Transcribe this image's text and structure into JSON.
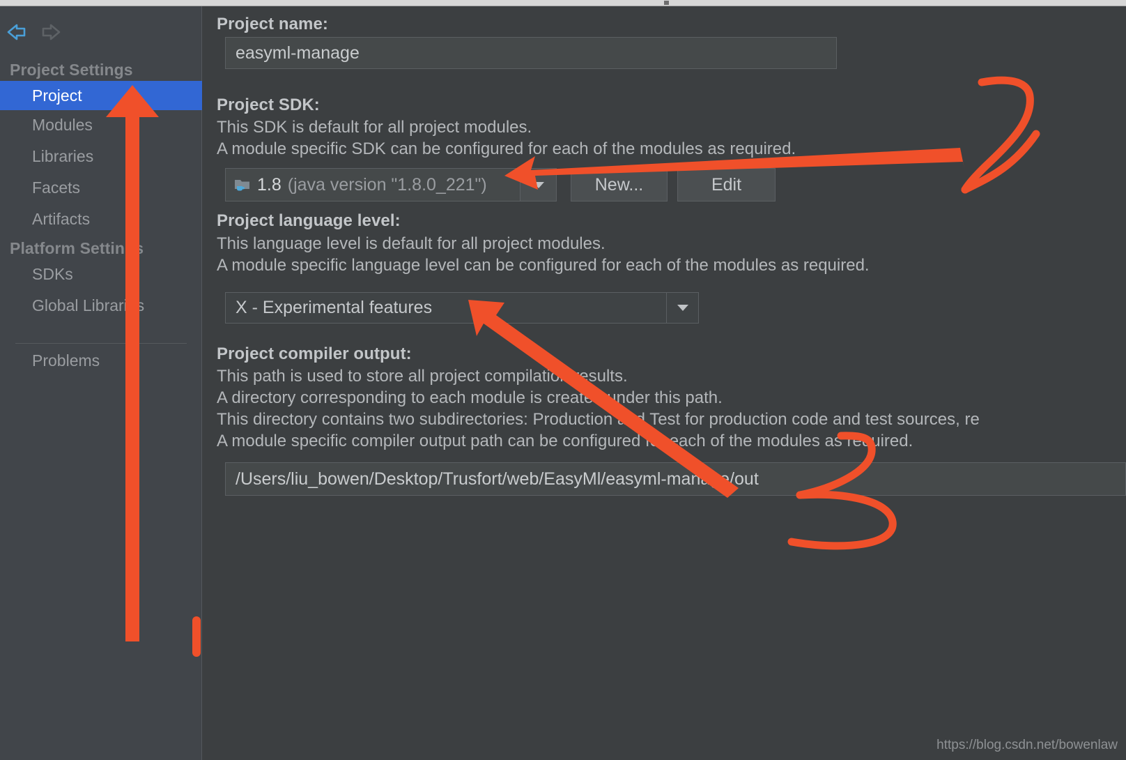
{
  "window": {
    "background_color": "#3c3f41",
    "sidebar_color": "#41454a",
    "accent_color": "#3267d4",
    "annotation_color": "#f0502a"
  },
  "nav": {
    "back_icon": "arrow-left-icon",
    "forward_icon": "arrow-right-icon"
  },
  "sidebar": {
    "groups": [
      {
        "title": "Project Settings",
        "items": [
          {
            "label": "Project",
            "selected": true
          },
          {
            "label": "Modules",
            "selected": false
          },
          {
            "label": "Libraries",
            "selected": false
          },
          {
            "label": "Facets",
            "selected": false
          },
          {
            "label": "Artifacts",
            "selected": false
          }
        ]
      },
      {
        "title": "Platform Settings",
        "items": [
          {
            "label": "SDKs",
            "selected": false
          },
          {
            "label": "Global Libraries",
            "selected": false
          }
        ]
      }
    ],
    "footer_items": [
      {
        "label": "Problems",
        "selected": false
      }
    ]
  },
  "main": {
    "project_name": {
      "label": "Project name:",
      "value": "easyml-manage"
    },
    "project_sdk": {
      "label": "Project SDK:",
      "description_lines": [
        "This SDK is default for all project modules.",
        "A module specific SDK can be configured for each of the modules as required."
      ],
      "selected_version": "1.8",
      "selected_detail": "(java version \"1.8.0_221\")",
      "icon": "jdk-folder-icon",
      "dropdown_icon": "chevron-down-icon",
      "new_button": "New...",
      "edit_button": "Edit"
    },
    "language_level": {
      "label": "Project language level:",
      "description_lines": [
        "This language level is default for all project modules.",
        "A module specific language level can be configured for each of the modules as required."
      ],
      "value": "X - Experimental features",
      "dropdown_icon": "chevron-down-icon"
    },
    "compiler_output": {
      "label": "Project compiler output:",
      "description_lines": [
        "This path is used to store all project compilation results.",
        "A directory corresponding to each module is created under this path.",
        "This directory contains two subdirectories: Production and Test for production code and test sources, re",
        "A module specific compiler output path can be configured for each of the modules as required."
      ],
      "value": "/Users/liu_bowen/Desktop/Trusfort/web/EasyMl/easyml-manage/out"
    }
  },
  "annotations": {
    "marker_2": "2",
    "marker_3": "3",
    "arrows": [
      {
        "name": "arrow-to-project-sidebar-item"
      },
      {
        "name": "arrow-to-project-sdk-combo"
      },
      {
        "name": "arrow-to-language-level-combo"
      }
    ]
  },
  "watermark": {
    "text": "https://blog.csdn.net/bowenlaw"
  }
}
